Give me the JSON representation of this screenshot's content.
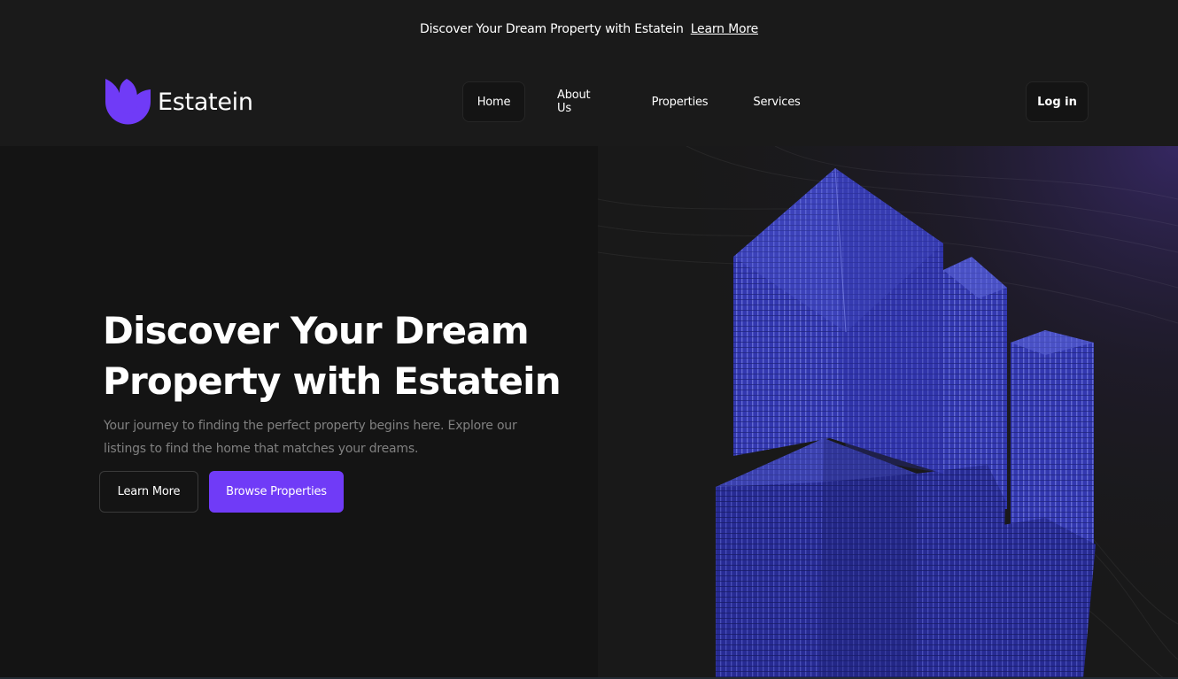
{
  "announcement": {
    "text": "Discover Your Dream Property with Estatein",
    "link_label": "Learn More"
  },
  "header": {
    "brand": "Estatein",
    "nav": [
      {
        "label": "Home",
        "active": true
      },
      {
        "label": "About Us",
        "active": false
      },
      {
        "label": "Properties",
        "active": false
      },
      {
        "label": "Services",
        "active": false
      }
    ],
    "login_label": "Log in"
  },
  "hero": {
    "title": "Discover Your Dream Property with Estatein",
    "subtitle": "Your journey to finding the perfect property begins here. Explore our listings to find the home that matches your dreams.",
    "learn_more_label": "Learn More",
    "browse_label": "Browse Properties",
    "image_icon": "building-image"
  },
  "colors": {
    "accent": "#703bf7",
    "background": "#141414",
    "header_bg": "#1a1a1a",
    "muted_text": "#808080",
    "building_blue": "#3a3fb8"
  }
}
